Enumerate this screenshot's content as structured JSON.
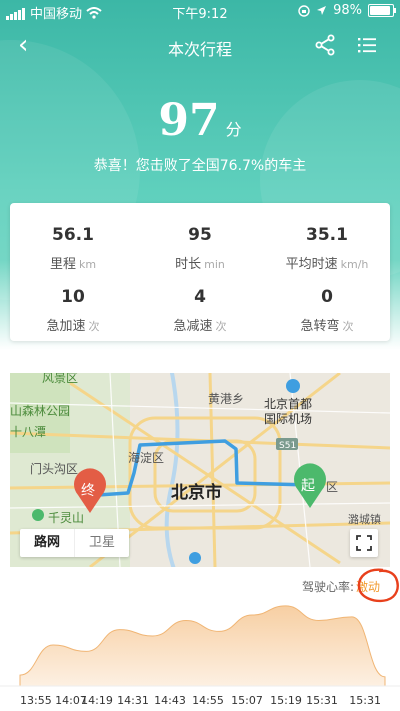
{
  "status_bar": {
    "carrier": "中国移动",
    "time": "下午9:12",
    "battery_percent": "98%",
    "battery_level": 0.98
  },
  "nav": {
    "title": "本次行程",
    "back_icon": "chevron-left-icon",
    "share_icon": "share-icon",
    "menu_icon": "list-menu-icon"
  },
  "score": {
    "value": "97",
    "unit": "分",
    "message": "恭喜！您击败了全国76.7%的车主"
  },
  "stats": [
    {
      "value": "56.1",
      "label": "里程",
      "unit": "km"
    },
    {
      "value": "95",
      "label": "时长",
      "unit": "min"
    },
    {
      "value": "35.1",
      "label": "平均时速",
      "unit": "km/h"
    },
    {
      "value": "10",
      "label": "急加速",
      "unit": "次"
    },
    {
      "value": "4",
      "label": "急减速",
      "unit": "次"
    },
    {
      "value": "0",
      "label": "急转弯",
      "unit": "次"
    }
  ],
  "map": {
    "labels": {
      "city": "北京市",
      "haidian": "海淀区",
      "mentougou": "门头沟区",
      "fengtai_top": "风景区",
      "forest_park": "山森林公园",
      "shibadeng": "十八潭",
      "qianlingshan": "千灵山",
      "huangganxiang": "黄港乡",
      "airport": "北京首都国际机场",
      "road_s51": "S51",
      "luchengzhen": "潞城镇",
      "region_right": "区"
    },
    "start_marker": "起",
    "end_marker": "终",
    "tab_road": "路网",
    "tab_satellite": "卫星",
    "expand_icon": "expand-icon",
    "colors": {
      "route": "#3f9ee0",
      "start": "#4cb96c",
      "end": "#e35d45"
    }
  },
  "heart_rate": {
    "label": "驾驶心率:",
    "value": "激动",
    "accent": "#f29a2e"
  },
  "chart_data": {
    "type": "area",
    "x": [
      "13:55",
      "14:07",
      "14:19",
      "14:31",
      "14:43",
      "14:55",
      "15:07",
      "15:19",
      "15:31",
      "15:31"
    ],
    "values": [
      0.12,
      0.45,
      0.38,
      0.62,
      0.55,
      0.72,
      0.6,
      0.78,
      0.88,
      0.72,
      0.76,
      0.1
    ],
    "title": "",
    "xlabel": "",
    "ylabel": "",
    "ylim": [
      0,
      1
    ],
    "grid": false,
    "color": "#f7cfa3"
  }
}
